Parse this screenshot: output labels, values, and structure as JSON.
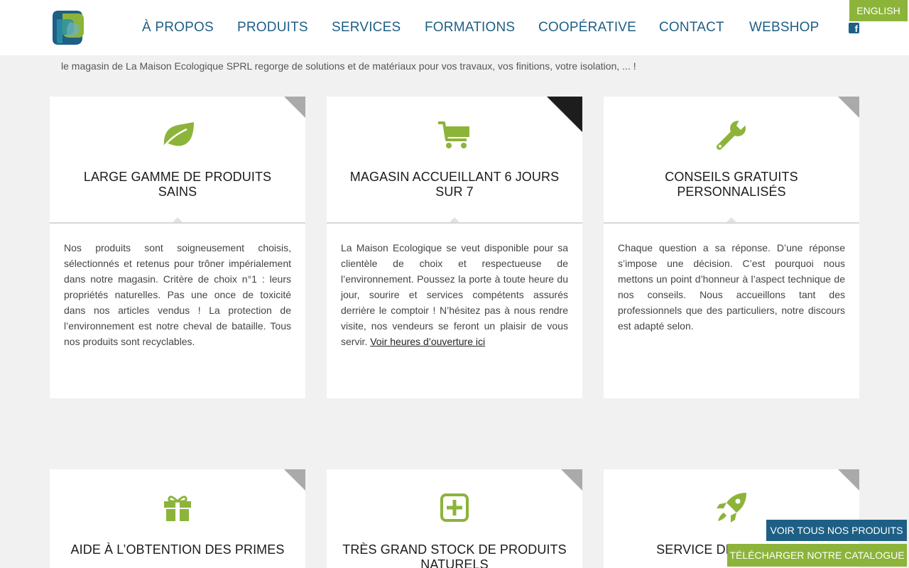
{
  "header": {
    "nav": [
      "À PROPOS",
      "PRODUITS",
      "SERVICES",
      "FORMATIONS",
      "COOPÉRATIVE",
      "CONTACT",
      "WEBSHOP"
    ],
    "facebook_icon": "facebook-icon",
    "language_label": "ENGLISH"
  },
  "intro": "le magasin de La Maison Ecologique SPRL regorge de solutions et de matériaux pour vos travaux, vos finitions, votre isolation, ... !",
  "colors": {
    "primary_blue": "#1e5f85",
    "accent_green": "#8cb43a",
    "background": "#f1f1f1"
  },
  "cards": [
    {
      "icon": "leaf-icon",
      "title": "LARGE GAMME DE PRODUITS SAINS",
      "text": "Nos produits sont soigneusement choisis, sélectionnés et retenus pour trôner impérialement dans notre magasin. Critère de choix n°1 : leurs propriétés naturelles. Pas une once de toxicité dans nos articles vendus ! La protection de l’environnement est notre cheval de bataille. Tous nos produits sont recyclables."
    },
    {
      "icon": "shopping-cart-icon",
      "title": "MAGASIN ACCUEILLANT 6 JOURS SUR 7",
      "text": "La Maison Ecologique se veut disponible pour sa clientèle de choix et respectueuse de l’environnement. Poussez la porte à toute heure du jour, sourire et services compétents assurés derrière le comptoir ! N’hésitez pas à nous rendre visite, nos vendeurs se feront un plaisir de vous servir.",
      "link": "Voir heures d’ouverture ici"
    },
    {
      "icon": "wrench-icon",
      "title": "CONSEILS GRATUITS PERSONNALISÉS",
      "text": "Chaque question a sa réponse. D’une réponse s’impose une décision. C’est pourquoi nous mettons un point d’honneur à l’aspect technique de nos conseils. Nous accueillons tant des professionnels que des particuliers, notre discours est adapté selon."
    },
    {
      "icon": "gift-icon",
      "title": "AIDE À L’OBTENTION DES PRIMES"
    },
    {
      "icon": "plus-square-icon",
      "title": "TRÈS GRAND STOCK DE PRODUITS NATURELS"
    },
    {
      "icon": "rocket-icon",
      "title": "SERVICE DE LIVRAISON"
    }
  ],
  "buttons": {
    "products": "VOIR TOUS NOS PRODUITS",
    "catalogue": "TÉLÉCHARGER NOTRE CATALOGUE"
  }
}
